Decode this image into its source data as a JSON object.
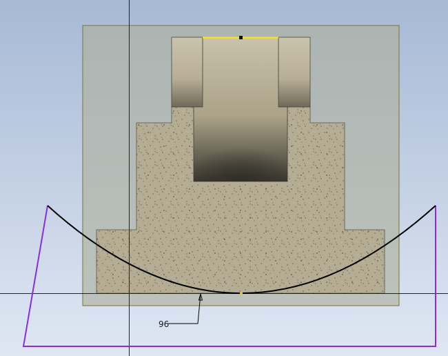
{
  "canvas": {
    "background_top": "#a9bcd8",
    "background_bottom": "#dde6f3"
  },
  "colors": {
    "sketch_frame": "#7a7430",
    "part_block": "#a9a68c",
    "concrete": "#b3ab8f",
    "selected_edge": "#ffea00",
    "profile_line": "#8a2be2",
    "arc": "#000000",
    "axis": "#1f1f1f"
  },
  "dimension": {
    "value": "96"
  },
  "icons": {
    "arc_point": "arc-point-glyph",
    "dimension_arrow": "arrowhead-icon"
  }
}
